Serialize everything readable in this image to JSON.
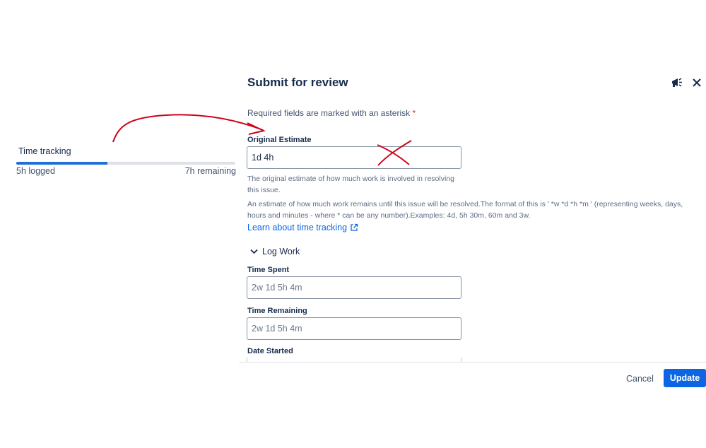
{
  "time_tracking": {
    "label": "Time tracking",
    "logged": "5h logged",
    "remaining": "7h remaining",
    "progress_percent": 41.7
  },
  "dialog": {
    "title": "Submit for review",
    "required_note": "Required fields are marked with an asterisk",
    "required_marker": "*",
    "original_estimate": {
      "label": "Original Estimate",
      "value": "1d 4h",
      "help": "The original estimate of how much work is involved in resolving this issue."
    },
    "remaining_help": "An estimate of how much work remains until this issue will be resolved.The format of this is ' *w *d *h *m ' (representing weeks, days, hours and minutes - where * can be any number).Examples: 4d, 5h 30m, 60m and 3w.",
    "learn_link": "Learn about time tracking",
    "log_work": {
      "toggle_label": "Log Work",
      "time_spent": {
        "label": "Time Spent",
        "placeholder": "2w 1d 5h 4m"
      },
      "time_remaining": {
        "label": "Time Remaining",
        "placeholder": "2w 1d 5h 4m"
      },
      "date_started": {
        "label": "Date Started"
      }
    },
    "buttons": {
      "cancel": "Cancel",
      "update": "Update"
    }
  },
  "colors": {
    "accent": "#0c66e4",
    "progress": "#1f6fd6",
    "annotation": "#d0021b"
  },
  "icons": [
    "feedback-megaphone-icon",
    "close-icon",
    "external-link-icon",
    "chevron-down-icon"
  ]
}
